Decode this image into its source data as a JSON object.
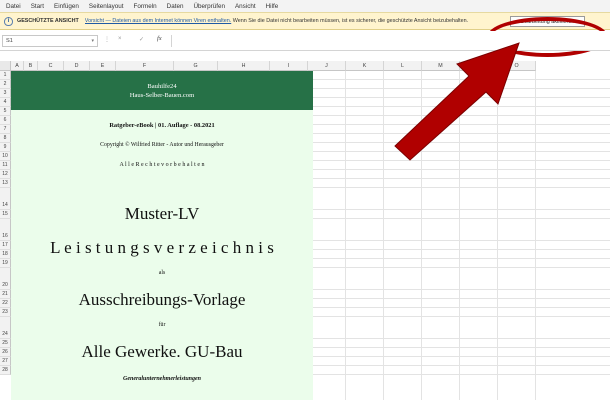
{
  "menu": [
    "Datei",
    "Start",
    "Einfügen",
    "Seitenlayout",
    "Formeln",
    "Daten",
    "Überprüfen",
    "Ansicht",
    "Hilfe"
  ],
  "protected_view": {
    "icon": "shield-info-icon",
    "title": "GESCHÜTZTE ANSICHT",
    "message_link": "Vorsicht — Dateien aus dem Internet können Viren enthalten.",
    "message_rest": " Wenn Sie die Datei nicht bearbeiten müssen, ist es sicherer, die geschützte Ansicht beizubehalten.",
    "button": "Bearbeitung aktivieren",
    "highlight_color": "#b00000"
  },
  "formula_bar": {
    "name_box": "S1",
    "cancel": "×",
    "enter": "✓",
    "fx": "fx",
    "content": ""
  },
  "columns": [
    "A",
    "B",
    "C",
    "D",
    "E",
    "F",
    "G",
    "H",
    "I",
    "J",
    "K",
    "L",
    "M",
    "N",
    "O"
  ],
  "rows": [
    "1",
    "2",
    "3",
    "4",
    "5",
    "6",
    "7",
    "8",
    "9",
    "10",
    "11",
    "12",
    "13",
    "14",
    "15",
    "16",
    "17",
    "18",
    "19",
    "20",
    "21",
    "22",
    "23",
    "24",
    "25",
    "26",
    "27",
    "28"
  ],
  "document": {
    "header_bg": "#267147",
    "body_bg": "#ebfdeb",
    "header_line1": "Bauhilfe24",
    "header_line2": "Haus-Selber-Bauen.com",
    "edition": "Ratgeber-eBook | 01. Auflage - 08.2021",
    "copyright": "Copyright © Wilfried Ritter - Autor und Herausgeber",
    "rights": "A l l e   R e c h t e   v o r b e h a l t e n",
    "title1": "Muster-LV",
    "title2": "L e i s t u n g s v e r z e i c h n i s",
    "word_als": "als",
    "title3": "Ausschreibungs-Vorlage",
    "word_fuer": "für",
    "title4": "Alle Gewerke. GU-Bau",
    "subtitle": "Generalunternehmerleistungen"
  },
  "arrow_color": "#b00000"
}
